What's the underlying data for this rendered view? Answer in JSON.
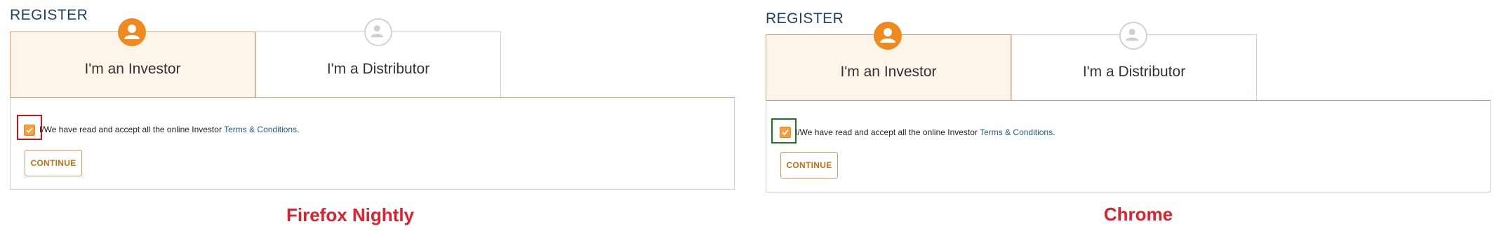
{
  "panels": [
    {
      "title": "REGISTER",
      "tabs": [
        {
          "label": "I'm an Investor",
          "active": true
        },
        {
          "label": "I'm a Distributor",
          "active": false
        }
      ],
      "terms_prefix": "I/We have read and accept all the online Investor ",
      "terms_link": "Terms & Conditions",
      "terms_suffix": ".",
      "checkbox_checked": true,
      "continue_label": "CONTINUE",
      "caption": "Firefox Nightly",
      "highlight_color": "#c8141e"
    },
    {
      "title": "REGISTER",
      "tabs": [
        {
          "label": "I'm an Investor",
          "active": true
        },
        {
          "label": "I'm a Distributor",
          "active": false
        }
      ],
      "terms_prefix": "I/We have read and accept all the online Investor ",
      "terms_link": "Terms & Conditions",
      "terms_suffix": ".",
      "checkbox_checked": true,
      "continue_label": "CONTINUE",
      "caption": "Chrome",
      "highlight_color": "#1a7a1a"
    }
  ],
  "colors": {
    "accent_orange": "#f08a1e",
    "title_blue": "#1e4263",
    "link_blue": "#1e5b8c",
    "caption_red": "#e0202a"
  }
}
